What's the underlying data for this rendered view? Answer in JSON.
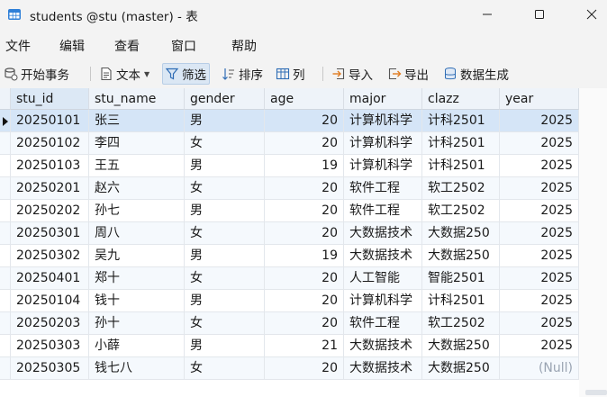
{
  "window": {
    "title": "students @stu (master) - 表",
    "app_icon": "table-app-icon"
  },
  "menu": [
    "文件",
    "编辑",
    "查看",
    "窗口",
    "帮助"
  ],
  "toolbar": {
    "begin_transaction": "开始事务",
    "text": "文本",
    "filter": "筛选",
    "sort": "排序",
    "columns": "列",
    "import": "导入",
    "export": "导出",
    "generate_data": "数据生成"
  },
  "columns": [
    "stu_id",
    "stu_name",
    "gender",
    "age",
    "major",
    "clazz",
    "year"
  ],
  "rows": [
    [
      "20250101",
      "张三",
      "男",
      "20",
      "计算机科学",
      "计科2501",
      "2025"
    ],
    [
      "20250102",
      "李四",
      "女",
      "20",
      "计算机科学",
      "计科2501",
      "2025"
    ],
    [
      "20250103",
      "王五",
      "男",
      "19",
      "计算机科学",
      "计科2501",
      "2025"
    ],
    [
      "20250201",
      "赵六",
      "女",
      "20",
      "软件工程",
      "软工2502",
      "2025"
    ],
    [
      "20250202",
      "孙七",
      "男",
      "20",
      "软件工程",
      "软工2502",
      "2025"
    ],
    [
      "20250301",
      "周八",
      "女",
      "20",
      "大数据技术",
      "大数据250",
      "2025"
    ],
    [
      "20250302",
      "吴九",
      "男",
      "19",
      "大数据技术",
      "大数据250",
      "2025"
    ],
    [
      "20250401",
      "郑十",
      "女",
      "20",
      "人工智能",
      "智能2501",
      "2025"
    ],
    [
      "20250104",
      "钱十",
      "男",
      "20",
      "计算机科学",
      "计科2501",
      "2025"
    ],
    [
      "20250203",
      "孙十",
      "女",
      "20",
      "软件工程",
      "软工2502",
      "2025"
    ],
    [
      "20250303",
      "小薛",
      "男",
      "21",
      "大数据技术",
      "大数据250",
      "2025"
    ],
    [
      "20250305",
      "钱七八",
      "女",
      "20",
      "大数据技术",
      "大数据250",
      "(Null)"
    ]
  ],
  "selected_row": 0,
  "colors": {
    "header_bg": "#eef3f9",
    "selected_row_bg": "#d5e5f7",
    "null_text": "#9aa4b2"
  }
}
